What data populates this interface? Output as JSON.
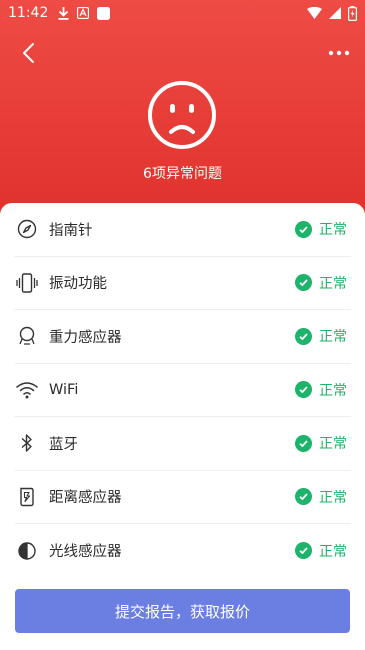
{
  "status_bar": {
    "time": "11:42"
  },
  "header": {
    "issues_text": "6项异常问题"
  },
  "items": [
    {
      "label": "指南针",
      "icon": "compass-icon",
      "status": "正常"
    },
    {
      "label": "振动功能",
      "icon": "vibration-icon",
      "status": "正常"
    },
    {
      "label": "重力感应器",
      "icon": "gravity-sensor-icon",
      "status": "正常"
    },
    {
      "label": "WiFi",
      "icon": "wifi-icon",
      "status": "正常"
    },
    {
      "label": "蓝牙",
      "icon": "bluetooth-icon",
      "status": "正常"
    },
    {
      "label": "距离感应器",
      "icon": "proximity-sensor-icon",
      "status": "正常"
    },
    {
      "label": "光线感应器",
      "icon": "light-sensor-icon",
      "status": "正常"
    }
  ],
  "submit_button": {
    "label": "提交报告，获取报价"
  },
  "colors": {
    "header_red": "#e0322d",
    "status_green": "#1cb36a",
    "button_blue": "#6b7fe3"
  }
}
